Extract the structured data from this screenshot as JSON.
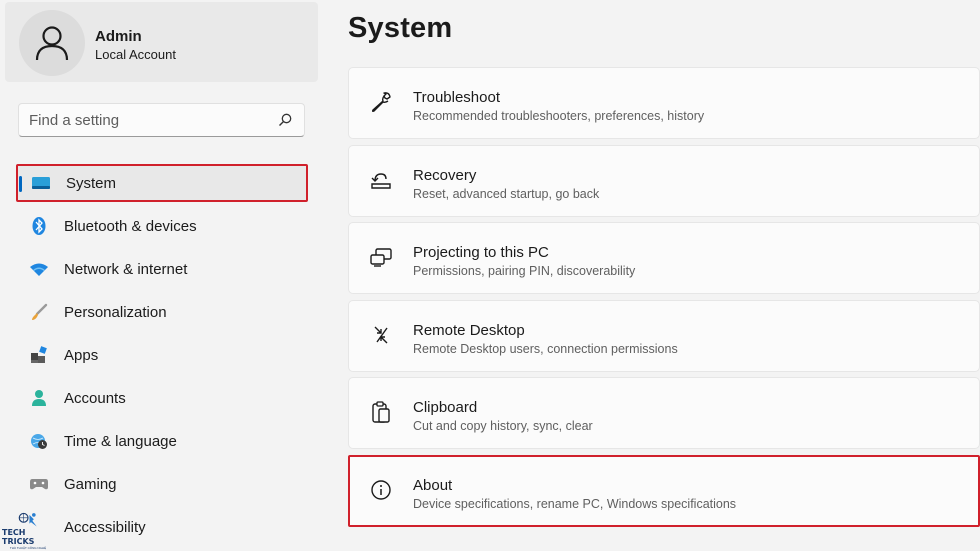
{
  "user": {
    "name": "Admin",
    "account_type": "Local Account"
  },
  "search": {
    "placeholder": "Find a setting"
  },
  "sidebar": {
    "items": [
      {
        "label": "System",
        "icon": "monitor-icon",
        "active": true
      },
      {
        "label": "Bluetooth & devices",
        "icon": "bluetooth-icon"
      },
      {
        "label": "Network & internet",
        "icon": "wifi-icon"
      },
      {
        "label": "Personalization",
        "icon": "brush-icon"
      },
      {
        "label": "Apps",
        "icon": "apps-icon"
      },
      {
        "label": "Accounts",
        "icon": "person-icon"
      },
      {
        "label": "Time & language",
        "icon": "globe-clock-icon"
      },
      {
        "label": "Gaming",
        "icon": "gamepad-icon"
      },
      {
        "label": "Accessibility",
        "icon": "accessibility-icon"
      }
    ]
  },
  "main": {
    "title": "System",
    "cards": [
      {
        "title": "Troubleshoot",
        "description": "Recommended troubleshooters, preferences, history",
        "icon": "wrench-icon"
      },
      {
        "title": "Recovery",
        "description": "Reset, advanced startup, go back",
        "icon": "recovery-icon"
      },
      {
        "title": "Projecting to this PC",
        "description": "Permissions, pairing PIN, discoverability",
        "icon": "projecting-icon"
      },
      {
        "title": "Remote Desktop",
        "description": "Remote Desktop users, connection permissions",
        "icon": "remote-desktop-icon"
      },
      {
        "title": "Clipboard",
        "description": "Cut and copy history, sync, clear",
        "icon": "clipboard-icon"
      },
      {
        "title": "About",
        "description": "Device specifications, rename PC, Windows specifications",
        "icon": "info-icon",
        "highlighted": true
      }
    ]
  },
  "watermark": {
    "title": "TECH TRICKS",
    "subtitle": "THỦ THUẬT CÔNG NGHỆ"
  },
  "colors": {
    "accent": "#0067c0",
    "highlight_border": "#d0202b",
    "background": "#f3f3f3",
    "card": "#fbfbfb"
  }
}
